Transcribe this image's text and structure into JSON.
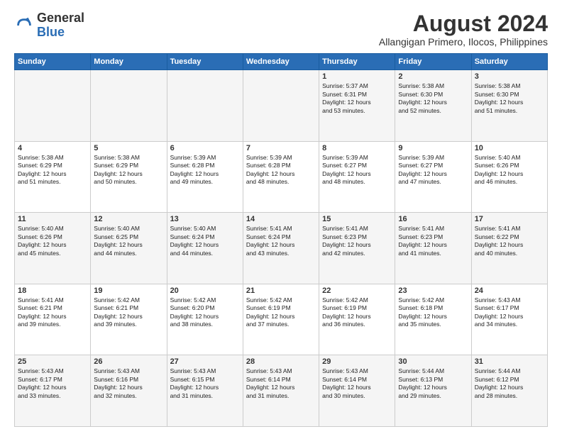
{
  "header": {
    "logo_general": "General",
    "logo_blue": "Blue",
    "month_year": "August 2024",
    "location": "Allangigan Primero, Ilocos, Philippines"
  },
  "days_of_week": [
    "Sunday",
    "Monday",
    "Tuesday",
    "Wednesday",
    "Thursday",
    "Friday",
    "Saturday"
  ],
  "weeks": [
    [
      {
        "day": "",
        "content": ""
      },
      {
        "day": "",
        "content": ""
      },
      {
        "day": "",
        "content": ""
      },
      {
        "day": "",
        "content": ""
      },
      {
        "day": "1",
        "content": "Sunrise: 5:37 AM\nSunset: 6:31 PM\nDaylight: 12 hours\nand 53 minutes."
      },
      {
        "day": "2",
        "content": "Sunrise: 5:38 AM\nSunset: 6:30 PM\nDaylight: 12 hours\nand 52 minutes."
      },
      {
        "day": "3",
        "content": "Sunrise: 5:38 AM\nSunset: 6:30 PM\nDaylight: 12 hours\nand 51 minutes."
      }
    ],
    [
      {
        "day": "4",
        "content": "Sunrise: 5:38 AM\nSunset: 6:29 PM\nDaylight: 12 hours\nand 51 minutes."
      },
      {
        "day": "5",
        "content": "Sunrise: 5:38 AM\nSunset: 6:29 PM\nDaylight: 12 hours\nand 50 minutes."
      },
      {
        "day": "6",
        "content": "Sunrise: 5:39 AM\nSunset: 6:28 PM\nDaylight: 12 hours\nand 49 minutes."
      },
      {
        "day": "7",
        "content": "Sunrise: 5:39 AM\nSunset: 6:28 PM\nDaylight: 12 hours\nand 48 minutes."
      },
      {
        "day": "8",
        "content": "Sunrise: 5:39 AM\nSunset: 6:27 PM\nDaylight: 12 hours\nand 48 minutes."
      },
      {
        "day": "9",
        "content": "Sunrise: 5:39 AM\nSunset: 6:27 PM\nDaylight: 12 hours\nand 47 minutes."
      },
      {
        "day": "10",
        "content": "Sunrise: 5:40 AM\nSunset: 6:26 PM\nDaylight: 12 hours\nand 46 minutes."
      }
    ],
    [
      {
        "day": "11",
        "content": "Sunrise: 5:40 AM\nSunset: 6:26 PM\nDaylight: 12 hours\nand 45 minutes."
      },
      {
        "day": "12",
        "content": "Sunrise: 5:40 AM\nSunset: 6:25 PM\nDaylight: 12 hours\nand 44 minutes."
      },
      {
        "day": "13",
        "content": "Sunrise: 5:40 AM\nSunset: 6:24 PM\nDaylight: 12 hours\nand 44 minutes."
      },
      {
        "day": "14",
        "content": "Sunrise: 5:41 AM\nSunset: 6:24 PM\nDaylight: 12 hours\nand 43 minutes."
      },
      {
        "day": "15",
        "content": "Sunrise: 5:41 AM\nSunset: 6:23 PM\nDaylight: 12 hours\nand 42 minutes."
      },
      {
        "day": "16",
        "content": "Sunrise: 5:41 AM\nSunset: 6:23 PM\nDaylight: 12 hours\nand 41 minutes."
      },
      {
        "day": "17",
        "content": "Sunrise: 5:41 AM\nSunset: 6:22 PM\nDaylight: 12 hours\nand 40 minutes."
      }
    ],
    [
      {
        "day": "18",
        "content": "Sunrise: 5:41 AM\nSunset: 6:21 PM\nDaylight: 12 hours\nand 39 minutes."
      },
      {
        "day": "19",
        "content": "Sunrise: 5:42 AM\nSunset: 6:21 PM\nDaylight: 12 hours\nand 39 minutes."
      },
      {
        "day": "20",
        "content": "Sunrise: 5:42 AM\nSunset: 6:20 PM\nDaylight: 12 hours\nand 38 minutes."
      },
      {
        "day": "21",
        "content": "Sunrise: 5:42 AM\nSunset: 6:19 PM\nDaylight: 12 hours\nand 37 minutes."
      },
      {
        "day": "22",
        "content": "Sunrise: 5:42 AM\nSunset: 6:19 PM\nDaylight: 12 hours\nand 36 minutes."
      },
      {
        "day": "23",
        "content": "Sunrise: 5:42 AM\nSunset: 6:18 PM\nDaylight: 12 hours\nand 35 minutes."
      },
      {
        "day": "24",
        "content": "Sunrise: 5:43 AM\nSunset: 6:17 PM\nDaylight: 12 hours\nand 34 minutes."
      }
    ],
    [
      {
        "day": "25",
        "content": "Sunrise: 5:43 AM\nSunset: 6:17 PM\nDaylight: 12 hours\nand 33 minutes."
      },
      {
        "day": "26",
        "content": "Sunrise: 5:43 AM\nSunset: 6:16 PM\nDaylight: 12 hours\nand 32 minutes."
      },
      {
        "day": "27",
        "content": "Sunrise: 5:43 AM\nSunset: 6:15 PM\nDaylight: 12 hours\nand 31 minutes."
      },
      {
        "day": "28",
        "content": "Sunrise: 5:43 AM\nSunset: 6:14 PM\nDaylight: 12 hours\nand 31 minutes."
      },
      {
        "day": "29",
        "content": "Sunrise: 5:43 AM\nSunset: 6:14 PM\nDaylight: 12 hours\nand 30 minutes."
      },
      {
        "day": "30",
        "content": "Sunrise: 5:44 AM\nSunset: 6:13 PM\nDaylight: 12 hours\nand 29 minutes."
      },
      {
        "day": "31",
        "content": "Sunrise: 5:44 AM\nSunset: 6:12 PM\nDaylight: 12 hours\nand 28 minutes."
      }
    ]
  ]
}
